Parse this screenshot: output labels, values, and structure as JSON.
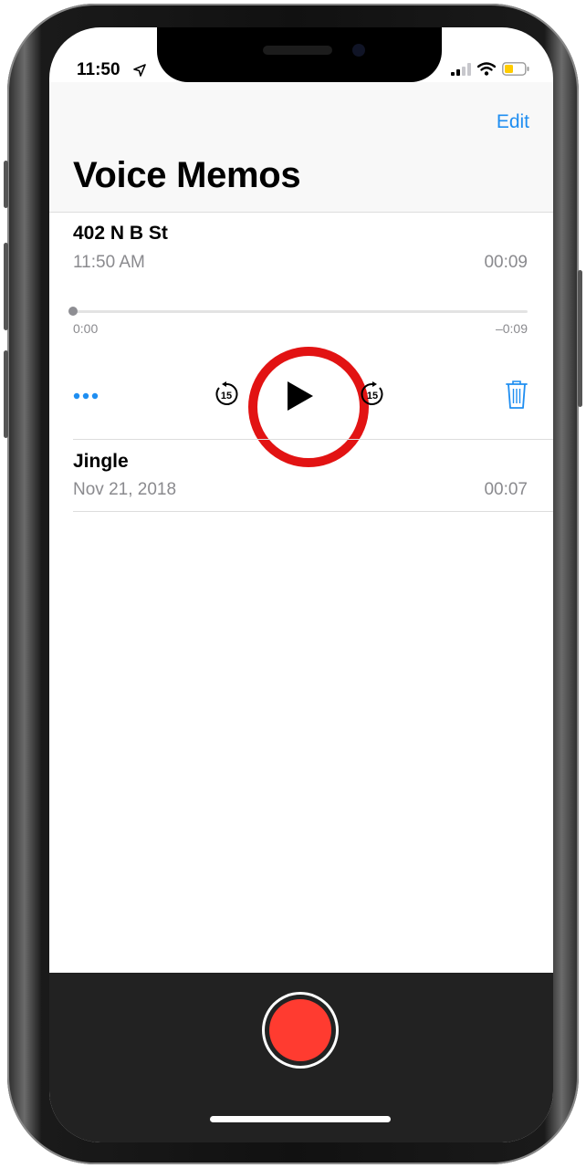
{
  "status": {
    "time": "11:50"
  },
  "header": {
    "edit_label": "Edit",
    "title": "Voice Memos"
  },
  "memos": [
    {
      "name": "402 N B St",
      "subtitle": "11:50 AM",
      "duration": "00:09",
      "expanded": true
    },
    {
      "name": "Jingle",
      "subtitle": "Nov 21, 2018",
      "duration": "00:07",
      "expanded": false
    }
  ],
  "player": {
    "elapsed": "0:00",
    "remaining": "–0:09",
    "progress": 0,
    "skip_seconds": "15"
  },
  "icons": {
    "location": "location-arrow-icon",
    "signal": "cellular-signal-icon",
    "wifi": "wifi-icon",
    "battery": "battery-icon",
    "more": "more-dots-icon",
    "skip_back": "skip-back-15-icon",
    "play": "play-icon",
    "skip_forward": "skip-forward-15-icon",
    "trash": "trash-icon",
    "record": "record-icon"
  },
  "colors": {
    "accent": "#1f8ef1",
    "record": "#ff3b30",
    "highlight": "#e21313",
    "battery": "#ffcc00"
  }
}
